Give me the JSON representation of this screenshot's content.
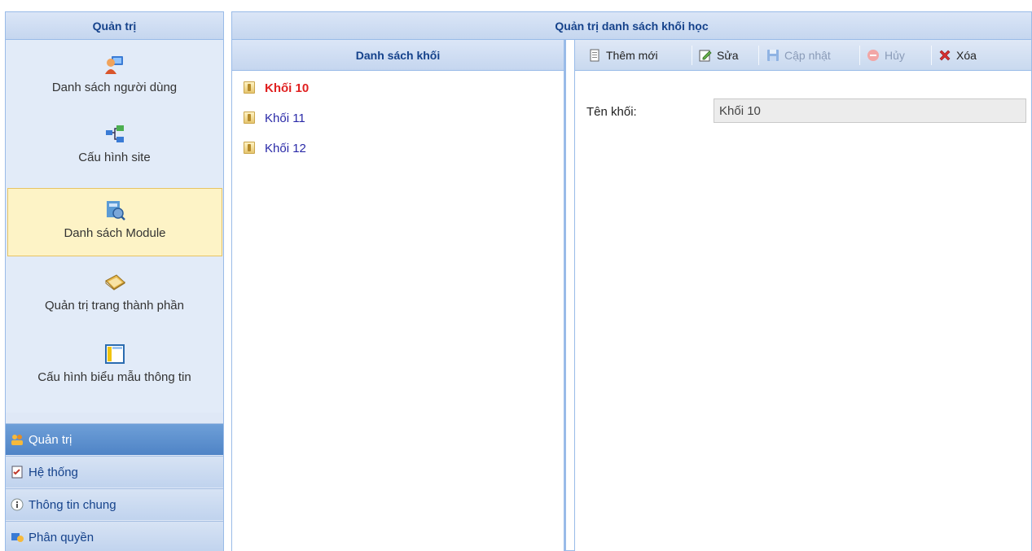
{
  "sidebar": {
    "title": "Quản trị",
    "items": [
      {
        "label": "Danh sách người dùng",
        "icon": "users-icon"
      },
      {
        "label": "Cấu hình site",
        "icon": "network-icon"
      },
      {
        "label": "Danh sách Module",
        "icon": "module-icon",
        "active": true
      },
      {
        "label": "Quản trị trang thành phần",
        "icon": "book-icon"
      },
      {
        "label": "Cấu hình biểu mẫu thông tin",
        "icon": "form-icon"
      }
    ],
    "accordion": [
      {
        "label": "Quản trị",
        "icon": "admin-group-icon",
        "active": true
      },
      {
        "label": "Hệ thống",
        "icon": "checklist-icon"
      },
      {
        "label": "Thông tin chung",
        "icon": "info-icon"
      },
      {
        "label": "Phân quyền",
        "icon": "permission-icon"
      }
    ]
  },
  "main": {
    "title": "Quản trị danh sách khối học",
    "list": {
      "title": "Danh sách khối",
      "items": [
        {
          "label": "Khối 10",
          "selected": true
        },
        {
          "label": "Khối 11"
        },
        {
          "label": "Khối 12"
        }
      ]
    },
    "toolbar": {
      "add": "Thêm mới",
      "edit": "Sửa",
      "update": "Cập nhật",
      "cancel": "Hủy",
      "delete": "Xóa"
    },
    "form": {
      "name_label": "Tên khối:",
      "name_value": "Khối 10"
    }
  },
  "colors": {
    "header_text": "#15428b",
    "selected_item": "#e02020",
    "link": "#2a2aa8",
    "active_bg": "#fdf3c6"
  }
}
